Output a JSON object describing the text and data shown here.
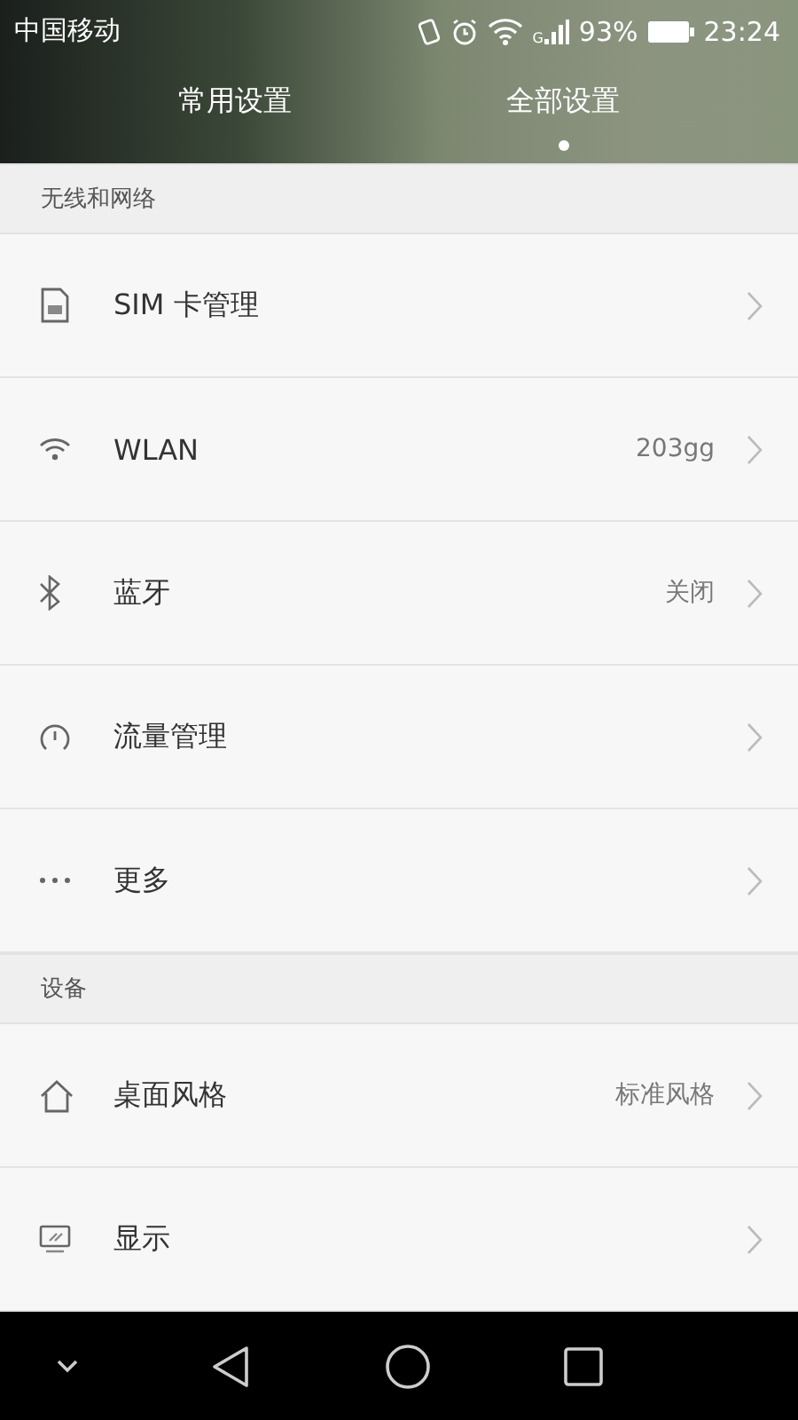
{
  "status_bar": {
    "carrier": "中国移动",
    "signal_label": "G",
    "battery_percent": "93%",
    "time": "23:24"
  },
  "tabs": [
    {
      "label": "常用设置",
      "selected": false
    },
    {
      "label": "全部设置",
      "selected": true
    }
  ],
  "sections": [
    {
      "title": "无线和网络",
      "items": [
        {
          "label": "SIM 卡管理"
        },
        {
          "label": "WLAN",
          "value": "203gg"
        },
        {
          "label": "蓝牙",
          "value": "关闭"
        },
        {
          "label": "流量管理"
        },
        {
          "label": "更多"
        }
      ]
    },
    {
      "title": "设备",
      "items": [
        {
          "label": "桌面风格",
          "value": "标准风格"
        },
        {
          "label": "显示"
        }
      ]
    }
  ]
}
